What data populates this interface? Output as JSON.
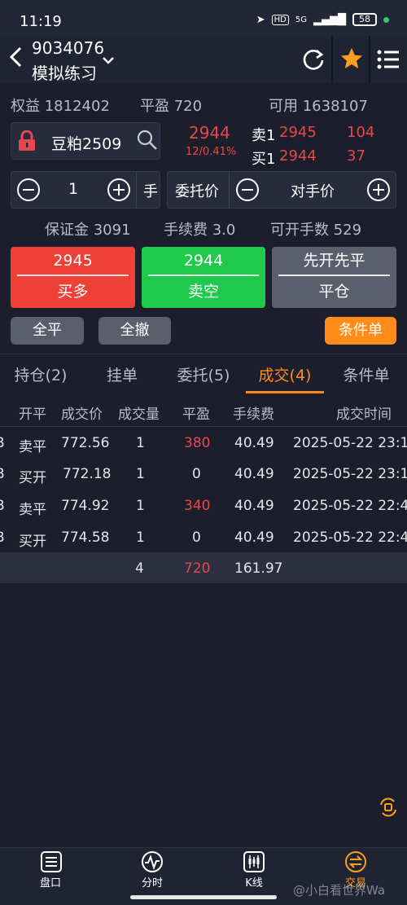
{
  "status_bar": {
    "time": "11:19",
    "network": "5G",
    "battery": "58"
  },
  "header": {
    "account_no": "9034076",
    "account_name": "模拟练习"
  },
  "summary": {
    "equity_label": "权益",
    "equity": "1812402",
    "pnl_label": "平盈",
    "pnl": "720",
    "available_label": "可用",
    "available": "1638107"
  },
  "instrument": {
    "name": "豆粕2509",
    "last_price": "2944",
    "change": "12/0.41%",
    "ask_label": "卖1",
    "ask_price": "2945",
    "ask_volume": "104",
    "bid_label": "买1",
    "bid_price": "2944",
    "bid_volume": "37"
  },
  "order_form": {
    "quantity": "1",
    "unit": "手",
    "price_type_label": "委托价",
    "price_mode": "对手价",
    "margin_label": "保证金",
    "margin": "3091",
    "fee_label": "手续费",
    "fee": "3.0",
    "max_open_label": "可开手数",
    "max_open": "529"
  },
  "actions": {
    "buy_price": "2945",
    "buy_label": "买多",
    "sell_price": "2944",
    "sell_label": "卖空",
    "close_mode": "先开先平",
    "close_label": "平仓",
    "close_all": "全平",
    "cancel_all": "全撤",
    "conditional": "条件单"
  },
  "tabs": [
    "持仓(2)",
    "挂单",
    "委托(5)",
    "成交(4)",
    "条件单"
  ],
  "trades": {
    "headers": [
      "开平",
      "成交价",
      "成交量",
      "平盈",
      "手续费",
      "成交时间"
    ],
    "rows": [
      {
        "prefix": "B",
        "side": "卖平",
        "price": "772.56",
        "qty": "1",
        "pnl": "380",
        "fee": "40.49",
        "time": "2025-05-22 23:1"
      },
      {
        "prefix": "B",
        "side": "买开",
        "price": "772.18",
        "qty": "1",
        "pnl": "0",
        "fee": "40.49",
        "time": "2025-05-22 23:1"
      },
      {
        "prefix": "B",
        "side": "卖平",
        "price": "774.92",
        "qty": "1",
        "pnl": "340",
        "fee": "40.49",
        "time": "2025-05-22 22:4"
      },
      {
        "prefix": "B",
        "side": "买开",
        "price": "774.58",
        "qty": "1",
        "pnl": "0",
        "fee": "40.49",
        "time": "2025-05-22 22:4"
      }
    ],
    "totals": {
      "qty": "4",
      "pnl": "720",
      "fee": "161.97"
    }
  },
  "bottom_nav": [
    "盘口",
    "分时",
    "K线",
    "交易"
  ],
  "watermark": "@小白看世界Wa"
}
